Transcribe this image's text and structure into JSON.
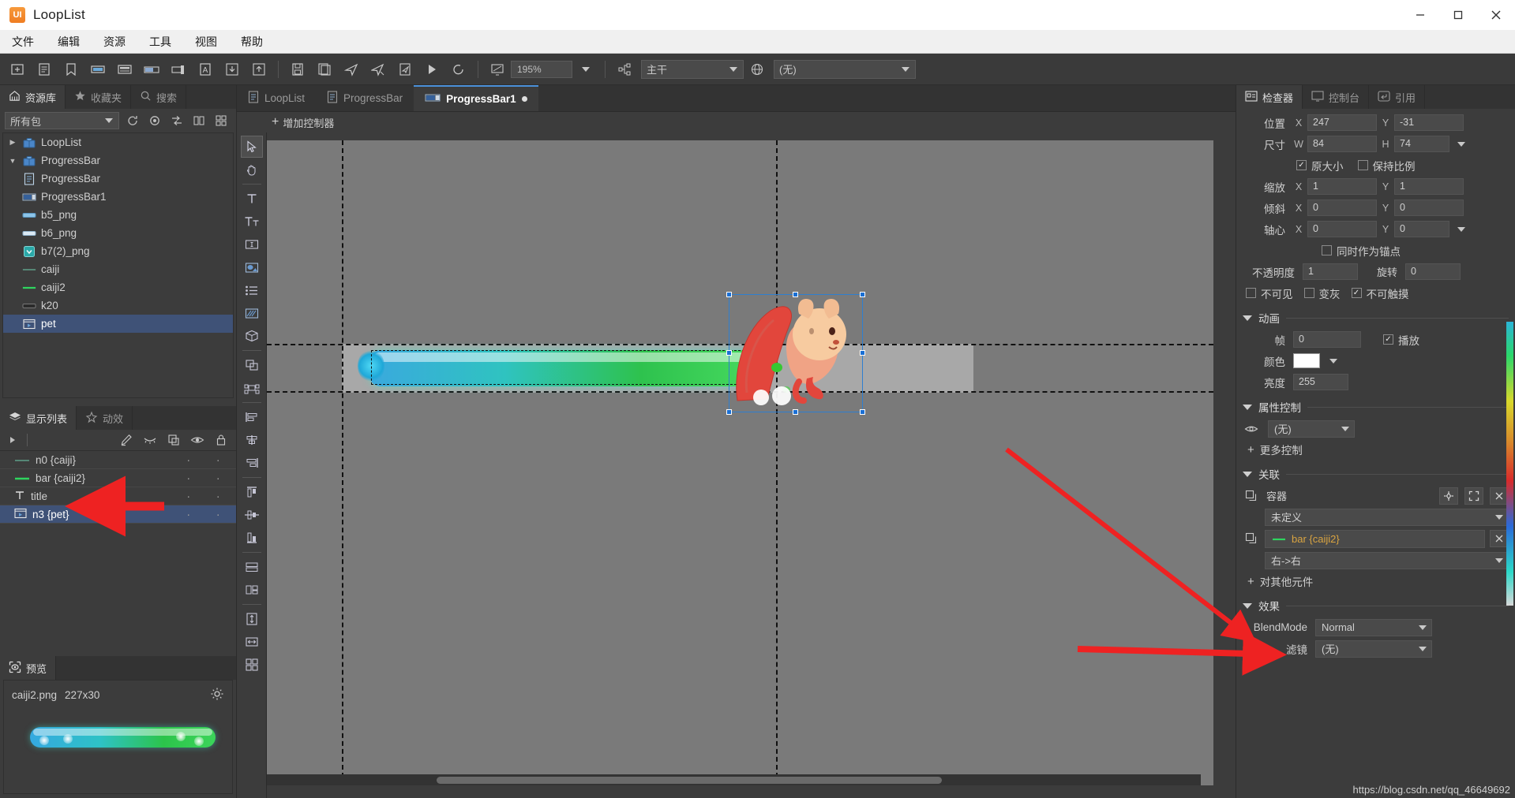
{
  "app": {
    "name": "LoopList",
    "logo_text": "UI"
  },
  "window_controls": {
    "minimize": "minimize-icon",
    "maximize": "maximize-icon",
    "close": "close-icon"
  },
  "menu": [
    "文件",
    "编辑",
    "资源",
    "工具",
    "视图",
    "帮助"
  ],
  "toolbar": {
    "save_label": "save-icon",
    "zoom_value": "195%",
    "branch_value": "主干",
    "package_value": "(无)",
    "icons": [
      "save",
      "save-all",
      "publish",
      "publish-all",
      "preview-publish",
      "play",
      "refresh",
      "screen"
    ]
  },
  "left_panel": {
    "tabs": [
      {
        "label": "资源库",
        "icon": "library-icon",
        "active": true
      },
      {
        "label": "收藏夹",
        "icon": "star-icon",
        "active": false
      },
      {
        "label": "搜索",
        "icon": "search-icon",
        "active": false
      }
    ],
    "filter_value": "所有包",
    "filter_icons": [
      "refresh-icon",
      "locate-icon",
      "sort-icon",
      "columns-icon",
      "grid-icon"
    ],
    "tree": [
      {
        "label": "LoopList",
        "icon": "package-icon",
        "indent": 0,
        "arrow": "▶",
        "selected": false
      },
      {
        "label": "ProgressBar",
        "icon": "package-icon",
        "indent": 0,
        "arrow": "▼",
        "selected": false
      },
      {
        "label": "ProgressBar",
        "icon": "component-icon",
        "indent": 1,
        "arrow": "",
        "selected": false
      },
      {
        "label": "ProgressBar1",
        "icon": "progressbar-icon",
        "indent": 1,
        "arrow": "",
        "selected": false
      },
      {
        "label": "b5_png",
        "icon": "image-blue-icon",
        "indent": 1,
        "arrow": "",
        "selected": false
      },
      {
        "label": "b6_png",
        "icon": "image-lightblue-icon",
        "indent": 1,
        "arrow": "",
        "selected": false
      },
      {
        "label": "b7(2)_png",
        "icon": "image-teal-icon",
        "indent": 1,
        "arrow": "",
        "selected": false
      },
      {
        "label": "caiji",
        "icon": "thinbar-icon",
        "indent": 1,
        "arrow": "",
        "selected": false
      },
      {
        "label": "caiji2",
        "icon": "greenbar-icon",
        "indent": 1,
        "arrow": "",
        "selected": false
      },
      {
        "label": "k20",
        "icon": "image-dark-icon",
        "indent": 1,
        "arrow": "",
        "selected": false
      },
      {
        "label": "pet",
        "icon": "movieclip-icon",
        "indent": 1,
        "arrow": "",
        "selected": true
      }
    ]
  },
  "display_list": {
    "tabs": [
      {
        "label": "显示列表",
        "icon": "layers-icon",
        "active": true
      },
      {
        "label": "动效",
        "icon": "sparkle-icon",
        "active": false
      }
    ],
    "toolbar_icons": [
      "expand-icon",
      "edit-icon",
      "hide-icon",
      "duplicate-icon",
      "eye-icon",
      "lock-icon"
    ],
    "rows": [
      {
        "label": "n0 {caiji}",
        "icon": "thinbar-icon",
        "selected": false
      },
      {
        "label": "bar {caiji2}",
        "icon": "greenbar-icon",
        "selected": false
      },
      {
        "label": "title",
        "icon": "text-icon",
        "selected": false
      },
      {
        "label": "n3 {pet}",
        "icon": "movieclip-icon",
        "selected": true
      }
    ]
  },
  "preview": {
    "tab_label": "预览",
    "tab_icon": "preview-icon",
    "file_name": "caiji2.png",
    "dimensions": "227x30",
    "gear_icon": "gear-icon"
  },
  "editor": {
    "doc_tabs": [
      {
        "label": "LoopList",
        "icon": "component-icon",
        "active": false,
        "dirty": false
      },
      {
        "label": "ProgressBar",
        "icon": "component-icon",
        "active": false,
        "dirty": false
      },
      {
        "label": "ProgressBar1",
        "icon": "progressbar-icon",
        "active": true,
        "dirty": true
      }
    ],
    "add_controller_label": "增加控制器",
    "vertical_tools": [
      "pointer-icon",
      "hand-icon",
      "text-icon",
      "richtext-icon",
      "input-icon",
      "loader-icon",
      "list-icon",
      "graph-icon",
      "cube3d-icon",
      "group-icon",
      "relation-icon",
      "align-left-icon",
      "align-center-icon",
      "align-right-icon",
      "align-top-icon",
      "align-middle-icon",
      "align-bottom-icon",
      "distribute-h-icon",
      "distribute-v-icon",
      "same-height-icon",
      "same-width-icon",
      "tile-icon"
    ]
  },
  "inspector": {
    "tabs": [
      {
        "label": "检查器",
        "icon": "inspector-icon",
        "active": true
      },
      {
        "label": "控制台",
        "icon": "console-icon",
        "active": false
      },
      {
        "label": "引用",
        "icon": "reference-icon",
        "active": false
      }
    ],
    "position": {
      "label": "位置",
      "x_prefix": "X",
      "x": "247",
      "y_prefix": "Y",
      "y": "-31"
    },
    "size": {
      "label": "尺寸",
      "w_prefix": "W",
      "w": "84",
      "h_prefix": "H",
      "h": "74"
    },
    "original_size": {
      "label": "原大小",
      "checked": true
    },
    "keep_ratio": {
      "label": "保持比例",
      "checked": false
    },
    "scale": {
      "label": "缩放",
      "x_prefix": "X",
      "x": "1",
      "y_prefix": "Y",
      "y": "1"
    },
    "skew": {
      "label": "倾斜",
      "x_prefix": "X",
      "x": "0",
      "y_prefix": "Y",
      "y": "0"
    },
    "pivot": {
      "label": "轴心",
      "x_prefix": "X",
      "x": "0",
      "y_prefix": "Y",
      "y": "0"
    },
    "as_anchor": {
      "label": "同时作为锚点",
      "checked": false
    },
    "opacity": {
      "label": "不透明度",
      "value": "1"
    },
    "rotation": {
      "label": "旋转",
      "value": "0"
    },
    "invisible": {
      "label": "不可见",
      "checked": false
    },
    "grayed": {
      "label": "变灰",
      "checked": false
    },
    "untouchable": {
      "label": "不可触摸",
      "checked": true
    },
    "animation_section": {
      "title": "动画"
    },
    "frame": {
      "label": "帧",
      "value": "0"
    },
    "playing": {
      "label": "播放",
      "checked": true
    },
    "color": {
      "label": "颜色",
      "value": "#ffffff"
    },
    "brightness": {
      "label": "亮度",
      "value": "255"
    },
    "property_control_section": {
      "title": "属性控制"
    },
    "property_control_value": "(无)",
    "more_control_label": "更多控制",
    "relation_section": {
      "title": "关联"
    },
    "container_label": "容器",
    "container_value": "未定义",
    "container_buttons": [
      "target-icon",
      "expand-icon",
      "close-icon"
    ],
    "related_element": "bar {caiji2}",
    "related_mode": "右->右",
    "add_other_label": "对其他元件",
    "effect_section": {
      "title": "效果"
    },
    "blendmode": {
      "label": "BlendMode",
      "value": "Normal"
    },
    "filter": {
      "label": "滤镜",
      "value": "(无)"
    }
  },
  "watermark": "https://blog.csdn.net/qq_46649692",
  "colors": {
    "accent_blue": "#4a90d9",
    "selection_blue": "#3f5277",
    "relation_orange": "#d9a441",
    "annotation_red": "#ee2222"
  }
}
